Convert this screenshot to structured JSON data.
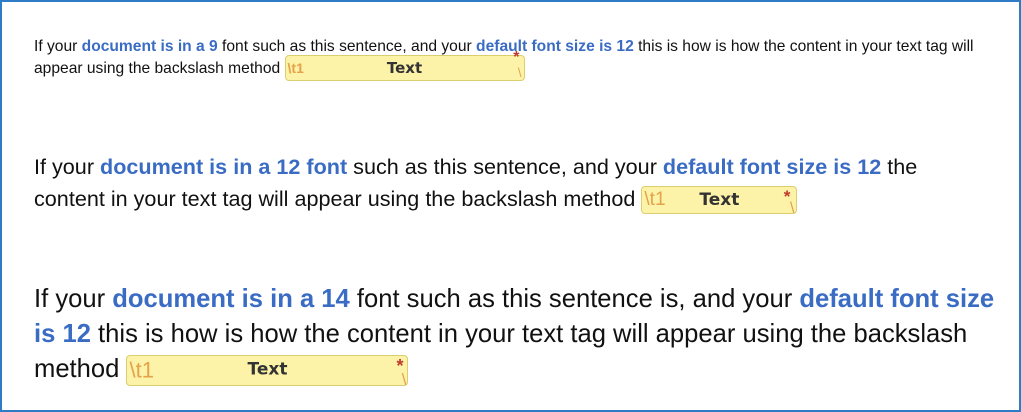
{
  "paragraph_9": {
    "t1": "If your ",
    "h1": "document is in a 9",
    "t2": " font such as this sentence, and your ",
    "h2": "default font size is 12",
    "t3": " this is how is how the content in your text tag will appear using the backslash method ",
    "tag": {
      "code": "\\t1",
      "label": "Text",
      "required_mark": "*",
      "end_mark": "\\"
    }
  },
  "paragraph_12": {
    "t1": "If your ",
    "h1": "document is in a 12 font",
    "t2": " such as this sentence, and your ",
    "h2": "default font size is 12",
    "t3": " the content in your text tag will appear using the backslash method ",
    "tag": {
      "code": "\\t1",
      "label": "Text",
      "required_mark": "*",
      "end_mark": "\\"
    }
  },
  "paragraph_14": {
    "t1": "If your ",
    "h1": "document is in a 14",
    "t2": " font such as this sentence is, and your ",
    "h2": "default font size is 12",
    "t3": " this is how is how the content in your text tag will appear using the backslash method ",
    "tag": {
      "code": "\\t1",
      "label": "Text",
      "required_mark": "*",
      "end_mark": "\\"
    }
  },
  "colors": {
    "highlight": "#3a6cc4",
    "frame": "#2e7bc6",
    "tag_bg": "#fcf3a8",
    "tag_code": "#e4a24a",
    "required": "#c0392b"
  }
}
